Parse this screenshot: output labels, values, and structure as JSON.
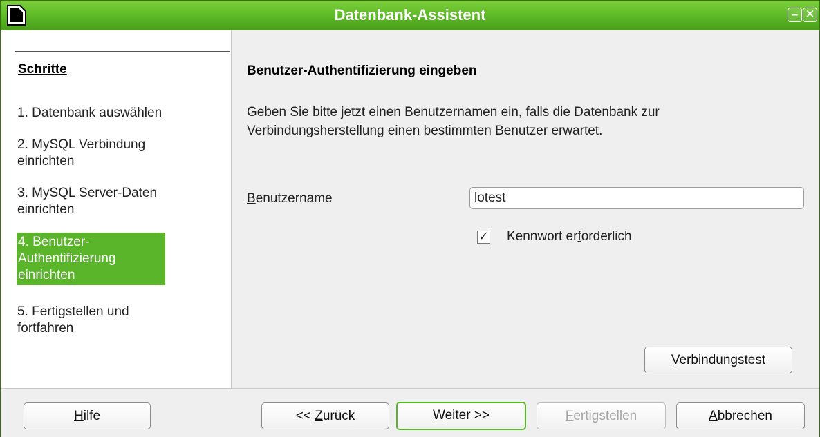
{
  "window": {
    "title": "Datenbank-Assistent",
    "minimize_glyph": "–",
    "close_glyph": "✕",
    "accent_color": "#5ab52b"
  },
  "steps": {
    "title": "Schritte",
    "items": [
      {
        "label_lines": [
          "1. Datenbank auswählen"
        ]
      },
      {
        "label_lines": [
          "2. MySQL Verbindung",
          "einrichten"
        ]
      },
      {
        "label_lines": [
          "3. MySQL Server-Daten",
          "einrichten"
        ]
      },
      {
        "label_lines": [
          "4. Benutzer-",
          "Authentifizierung",
          "einrichten"
        ],
        "active": true
      },
      {
        "label_lines": [
          "5. Fertigstellen und",
          "fortfahren"
        ]
      }
    ]
  },
  "main": {
    "heading": "Benutzer-Authentifizierung eingeben",
    "description_lines": [
      "Geben Sie bitte jetzt einen Benutzernamen ein, falls die Datenbank zur",
      "Verbindungsherstellung einen bestimmten Benutzer erwartet."
    ],
    "username_label_mnemonic": "B",
    "username_label_rest": "enutzername",
    "username_value": "lotest",
    "password_required": {
      "checked": true,
      "check_glyph": "✓",
      "label_pre": "Kennwort er",
      "label_mnemonic": "f",
      "label_post": "orderlich"
    },
    "test_button": {
      "mnemonic": "V",
      "rest": "erbindungstest"
    }
  },
  "buttons": {
    "help": {
      "mnemonic": "H",
      "rest": "ilfe"
    },
    "back": {
      "pre": "<< ",
      "mnemonic": "Z",
      "rest": "urück"
    },
    "next": {
      "mnemonic": "W",
      "rest": "eiter >>"
    },
    "finish": {
      "mnemonic": "F",
      "rest": "ertigstellen",
      "disabled": true
    },
    "cancel": {
      "mnemonic": "A",
      "rest": "bbrechen"
    }
  }
}
